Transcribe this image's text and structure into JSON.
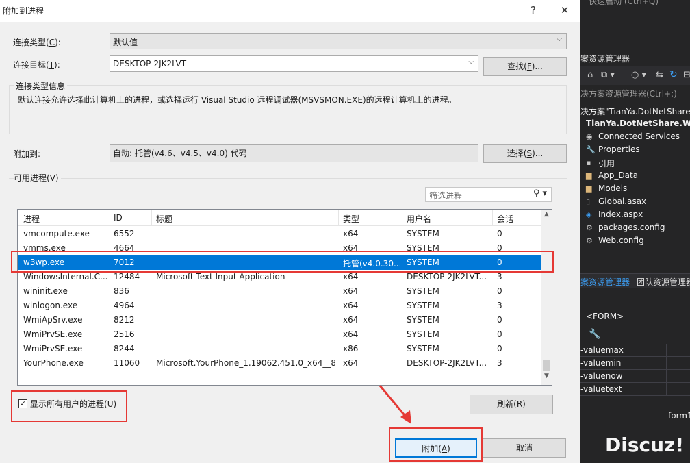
{
  "dialog": {
    "title": "附加到进程",
    "help": "?",
    "close": "✕",
    "connection_type_label": "连接类型(",
    "connection_type_key": "C",
    "connection_type_suffix": "):",
    "connection_type_value": "默认值",
    "connection_target_label": "连接目标(",
    "connection_target_key": "T",
    "connection_target_suffix": "):",
    "connection_target_value": "DESKTOP-2JK2LVT",
    "find_button_prefix": "查找(",
    "find_button_key": "F",
    "find_button_suffix": ")...",
    "info_group_title": "连接类型信息",
    "info_text": "默认连接允许选择此计算机上的进程，或选择运行 Visual Studio 远程调试器(MSVSMON.EXE)的远程计算机上的进程。",
    "attach_to_label": "附加到:",
    "attach_to_value": "自动: 托管(v4.6、v4.5、v4.0) 代码",
    "select_button_prefix": "选择(",
    "select_button_key": "S",
    "select_button_suffix": ")...",
    "available_label_prefix": "可用进程(",
    "available_label_key": "V",
    "available_label_suffix": ")",
    "filter_placeholder": "筛选进程",
    "columns": [
      "进程",
      "ID",
      "标题",
      "类型",
      "用户名",
      "会话"
    ],
    "rows": [
      [
        "vmcompute.exe",
        "6552",
        "",
        "x64",
        "SYSTEM",
        "0"
      ],
      [
        "vmms.exe",
        "4664",
        "",
        "x64",
        "SYSTEM",
        "0"
      ],
      [
        "w3wp.exe",
        "7012",
        "",
        "托管(v4.0.30...",
        "SYSTEM",
        "0"
      ],
      [
        "WindowsInternal.C...",
        "12484",
        "Microsoft Text Input Application",
        "x64",
        "DESKTOP-2JK2LVT...",
        "3"
      ],
      [
        "wininit.exe",
        "836",
        "",
        "x64",
        "SYSTEM",
        "0"
      ],
      [
        "winlogon.exe",
        "4964",
        "",
        "x64",
        "SYSTEM",
        "3"
      ],
      [
        "WmiApSrv.exe",
        "8212",
        "",
        "x64",
        "SYSTEM",
        "0"
      ],
      [
        "WmiPrvSE.exe",
        "2516",
        "",
        "x64",
        "SYSTEM",
        "0"
      ],
      [
        "WmiPrvSE.exe",
        "8244",
        "",
        "x86",
        "SYSTEM",
        "0"
      ],
      [
        "YourPhone.exe",
        "11060",
        "Microsoft.YourPhone_1.19062.451.0_x64__8...",
        "x64",
        "DESKTOP-2JK2LVT...",
        "3"
      ]
    ],
    "selected_row": 2,
    "show_all_users_prefix": "显示所有用户的进程(",
    "show_all_users_key": "U",
    "show_all_users_suffix": ")",
    "show_all_users_checked": true,
    "refresh_prefix": "刷新(",
    "refresh_key": "R",
    "refresh_suffix": ")",
    "attach_prefix": "附加(",
    "attach_key": "A",
    "attach_suffix": ")",
    "cancel_label": "取消"
  },
  "vs_panel": {
    "top_clip": "快速启动 (Ctrl+Q)",
    "explorer_title": "案资源管理器",
    "search_label": "决方案资源管理器(Ctrl+;)",
    "solution_label": "决方案\"TianYa.DotNetShare",
    "project_label": "TianYa.DotNetShare.Web",
    "items": [
      {
        "label": "Connected Services",
        "icon": "connected-services-icon"
      },
      {
        "label": "Properties",
        "icon": "wrench-icon"
      },
      {
        "label": "引用",
        "icon": "references-icon"
      },
      {
        "label": "App_Data",
        "icon": "folder-icon"
      },
      {
        "label": "Models",
        "icon": "folder-icon"
      },
      {
        "label": "Global.asax",
        "icon": "file-icon"
      },
      {
        "label": "Index.aspx",
        "icon": "web-file-icon"
      },
      {
        "label": "packages.config",
        "icon": "config-file-icon"
      },
      {
        "label": "Web.config",
        "icon": "config-file-icon"
      }
    ],
    "tab_explorer": "案资源管理器",
    "tab_team": "团队资源管理器",
    "props_element": "<FORM>",
    "props": [
      "-valuemax",
      "-valuemin",
      "-valuenow",
      "-valuetext"
    ],
    "footer_clip": "form1",
    "watermark": "Discuz!"
  }
}
